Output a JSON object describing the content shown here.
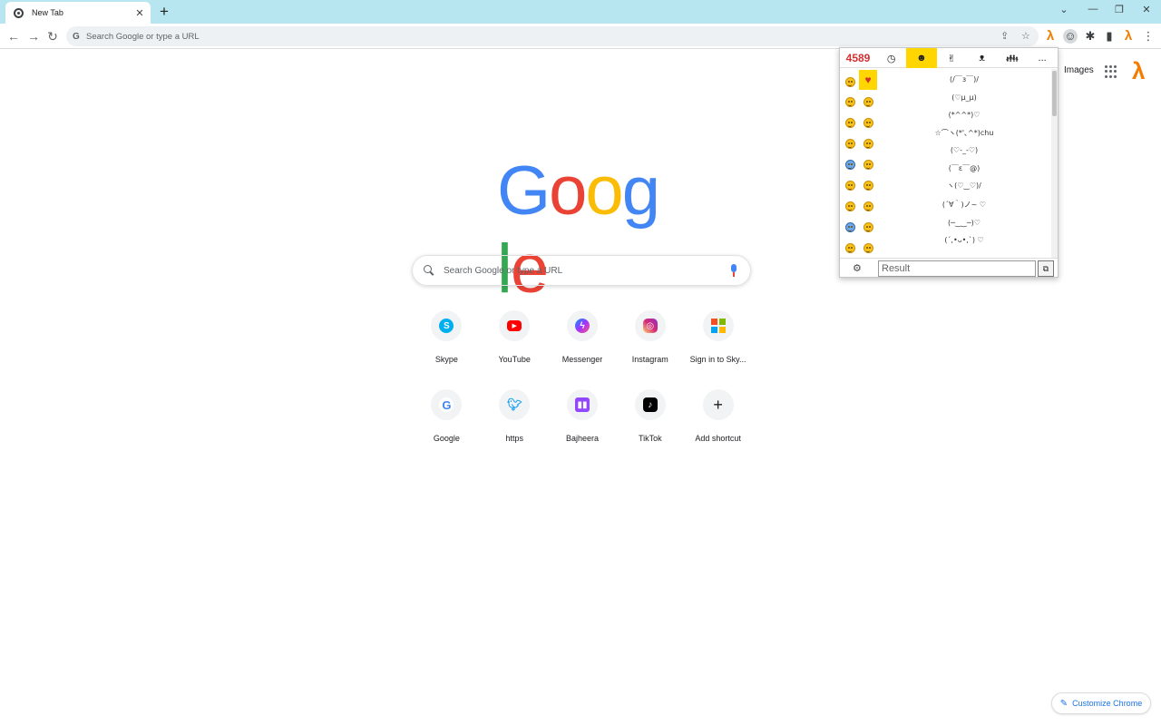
{
  "tab": {
    "title": "New Tab"
  },
  "omnibox": {
    "placeholder": "Search Google or type a URL"
  },
  "header": {
    "images_link": "Images"
  },
  "search": {
    "placeholder": "Search Google or type a URL"
  },
  "shortcuts": [
    {
      "label": "Skype",
      "icon": "skype-icon"
    },
    {
      "label": "YouTube",
      "icon": "youtube-icon"
    },
    {
      "label": "Messenger",
      "icon": "messenger-icon"
    },
    {
      "label": "Instagram",
      "icon": "instagram-icon"
    },
    {
      "label": "Sign in to Sky...",
      "icon": "microsoft-icon"
    },
    {
      "label": "Google",
      "icon": "google-icon"
    },
    {
      "label": "https",
      "icon": "twitter-icon"
    },
    {
      "label": "Bajheera",
      "icon": "twitch-icon"
    },
    {
      "label": "TikTok",
      "icon": "tiktok-icon"
    },
    {
      "label": "Add shortcut",
      "icon": "plus-icon"
    }
  ],
  "customize": {
    "label": "Customize Chrome"
  },
  "popup": {
    "count": "4589",
    "tabs": [
      "clock-icon",
      "smiley-icon",
      "hand-icon",
      "animal-icon",
      "people-icon",
      "more-icon"
    ],
    "more_label": "...",
    "kaomoji": [
      "(/￣з￣)/",
      "(♡μ_μ)",
      "(*^^*)♡",
      "☆⌒ヽ(*'､^*)chu",
      "(♡-_-♡)",
      "(￣ε￣@)",
      "ヽ(♡‿♡)/",
      "(´∀｀)ノ~ ♡",
      "(─‿‿─)♡",
      "(´,•ᴗ•,`) ♡"
    ],
    "result_placeholder": "Result"
  },
  "colors": {
    "tabstrip": "#b8e6f0",
    "accent": "#1a73e8",
    "lambda": "#f57c00",
    "popup_active": "#ffd600",
    "count": "#d32f2f"
  }
}
